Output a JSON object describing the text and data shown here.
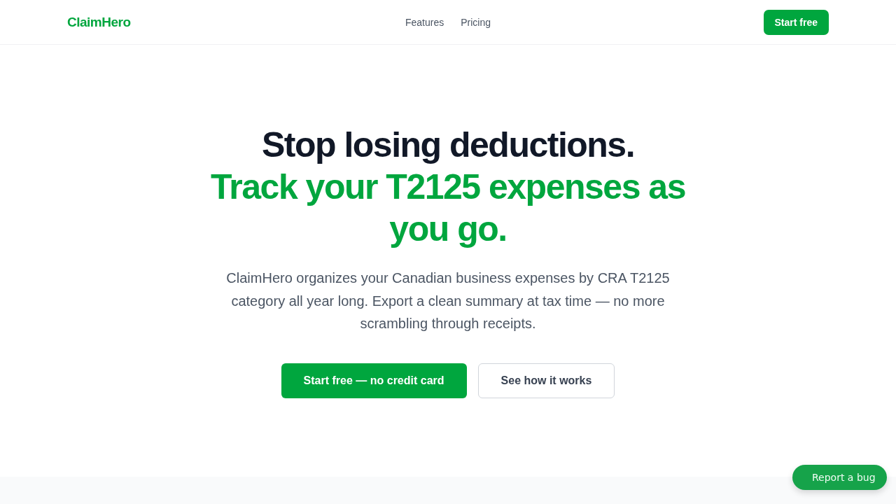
{
  "nav": {
    "logo": "ClaimHero",
    "links": [
      "Features",
      "Pricing"
    ],
    "cta": "Start free"
  },
  "hero": {
    "headline": "Stop losing deductions.",
    "subheadline": "Track your T2125 expenses as you go.",
    "description": "ClaimHero organizes your Canadian business expenses by CRA T2125 category all year long. Export a clean summary at tax time — no more scrambling through receipts.",
    "buttons": [
      {
        "label": "Start free — no credit card",
        "kind": "primary"
      },
      {
        "label": "See how it works",
        "kind": "secondary"
      }
    ]
  },
  "report_button": "Report a bug"
}
